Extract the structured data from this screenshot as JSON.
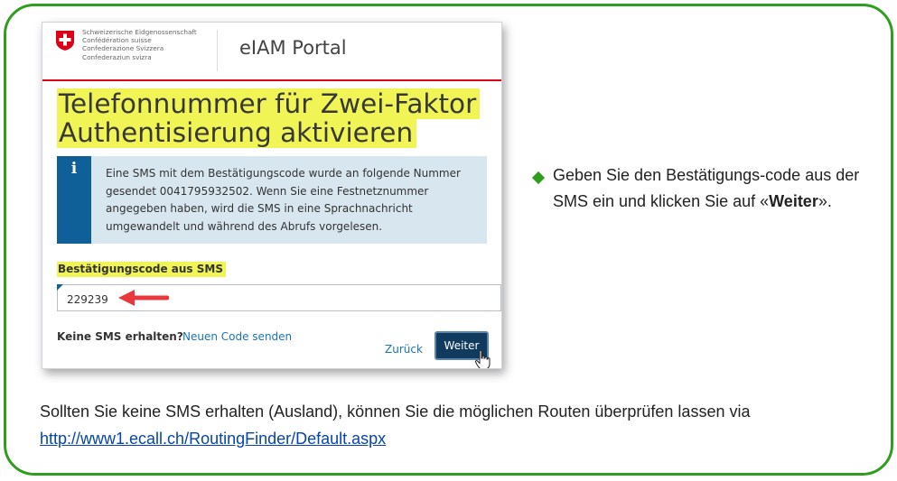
{
  "screenshot": {
    "header": {
      "confederation_lines": [
        "Schweizerische Eidgenossenschaft",
        "Confédération suisse",
        "Confederazione Svizzera",
        "Confederaziun svizra"
      ],
      "portal_title": "eIAM Portal"
    },
    "heading_line1": "Telefonnummer für Zwei-Faktor",
    "heading_line2": "Authentisierung aktivieren",
    "info_icon": "i",
    "info_text": "Eine SMS mit dem Bestätigungscode wurde an folgende Nummer gesendet 0041795932502. Wenn Sie eine Festnetznummer angegeben haben, wird die SMS in eine Sprachnachricht umgewandelt und während des Abrufs vorgelesen.",
    "code_field": {
      "label": "Bestätigungscode aus SMS",
      "value": "229239"
    },
    "no_sms_label": "Keine SMS erhalten?",
    "resend_link": "Neuen Code senden",
    "back_link": "Zurück",
    "next_button": "Weiter"
  },
  "instruction": {
    "text_before": "Geben Sie den Bestätigungs-code aus der SMS ein und klicken Sie auf «",
    "bold": "Weiter",
    "text_after": "»."
  },
  "footer": {
    "text": "Sollten Sie keine SMS erhalten (Ausland), können Sie die möglichen Routen überprüfen lassen via ",
    "link": "http://www1.ecall.ch/RoutingFinder/Default.aspx"
  },
  "colors": {
    "frame_border": "#2f9e1f",
    "highlight": "#f0f555",
    "swiss_red": "#dc0018",
    "info_blue": "#0f6099",
    "button_navy": "#113b5e"
  },
  "icons": [
    "swiss-cross-icon",
    "info-icon",
    "red-arrow-icon",
    "hand-cursor-icon",
    "diamond-bullet-icon"
  ]
}
